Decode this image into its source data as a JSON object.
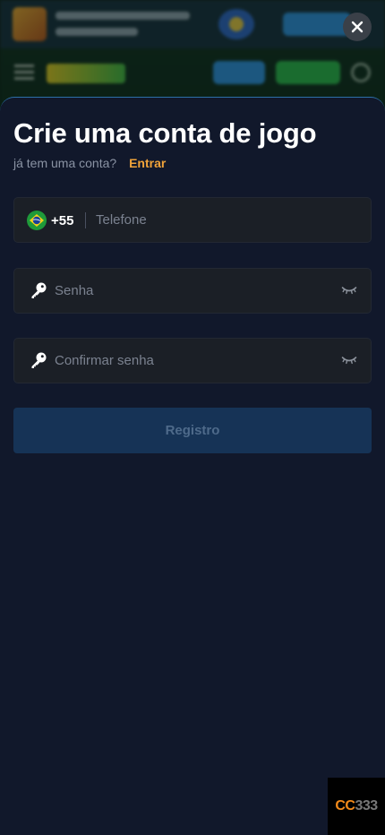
{
  "dialog": {
    "title": "Crie uma conta de jogo",
    "subtitle": "já tem uma conta?",
    "login_link": "Entrar"
  },
  "form": {
    "phone": {
      "country_flag": "brazil-flag-icon",
      "dial_code": "+55",
      "placeholder": "Telefone"
    },
    "password": {
      "placeholder": "Senha",
      "icon": "key-icon",
      "toggle_icon": "eye-closed-icon"
    },
    "confirm_password": {
      "placeholder": "Confirmar senha",
      "icon": "key-icon",
      "toggle_icon": "eye-closed-icon"
    },
    "submit_label": "Registro"
  },
  "close_icon": "close-icon",
  "watermark": {
    "part1": "CC",
    "part2": "333"
  },
  "colors": {
    "sheet_background": "#11182b",
    "field_background": "#1b1f26",
    "link_accent": "#f0a33a",
    "button_background": "#163356",
    "button_text": "#4e6a8a"
  }
}
